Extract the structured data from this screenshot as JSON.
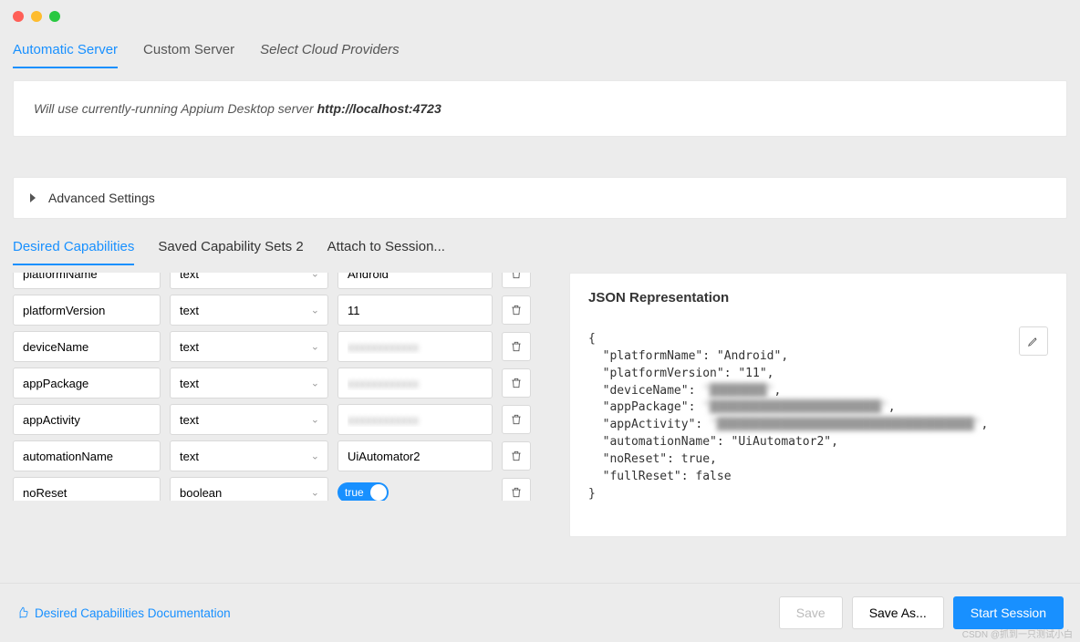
{
  "topTabs": {
    "automatic": "Automatic Server",
    "custom": "Custom Server",
    "cloud": "Select Cloud Providers"
  },
  "infoText": "Will use currently-running Appium Desktop server ",
  "infoUrl": "http://localhost:4723",
  "advanced": "Advanced Settings",
  "capTabs": {
    "desired": "Desired Capabilities",
    "saved": "Saved Capability Sets 2",
    "attach": "Attach to Session..."
  },
  "rows": [
    {
      "name": "platformName",
      "type": "text",
      "value": "Android"
    },
    {
      "name": "platformVersion",
      "type": "text",
      "value": "11"
    },
    {
      "name": "deviceName",
      "type": "text",
      "value": "████"
    },
    {
      "name": "appPackage",
      "type": "text",
      "value": "████████████"
    },
    {
      "name": "appActivity",
      "type": "text",
      "value": "████████████"
    },
    {
      "name": "automationName",
      "type": "text",
      "value": "UiAutomator2"
    },
    {
      "name": "noReset",
      "type": "boolean",
      "value": "true"
    }
  ],
  "jsonTitle": "JSON Representation",
  "jsonBody": {
    "open": "{",
    "lines": [
      {
        "k": "\"platformName\"",
        "v": "\"Android\"",
        "blur": false
      },
      {
        "k": "\"platformVersion\"",
        "v": "\"11\"",
        "blur": false
      },
      {
        "k": "\"deviceName\"",
        "v": "\"████████\"",
        "blur": true
      },
      {
        "k": "\"appPackage\"",
        "v": "\"████████████████████████\"",
        "blur": true
      },
      {
        "k": "\"appActivity\"",
        "v": "\"████████████████████████████████████\"",
        "blur": true
      },
      {
        "k": "\"automationName\"",
        "v": "\"UiAutomator2\"",
        "blur": false
      },
      {
        "k": "\"noReset\"",
        "v": "true",
        "blur": false
      },
      {
        "k": "\"fullReset\"",
        "v": "false",
        "blur": false
      }
    ],
    "close": "}"
  },
  "docLink": "Desired Capabilities Documentation",
  "buttons": {
    "save": "Save",
    "saveAs": "Save As...",
    "start": "Start Session"
  },
  "watermark": "CSDN @抓到一只测试小白"
}
